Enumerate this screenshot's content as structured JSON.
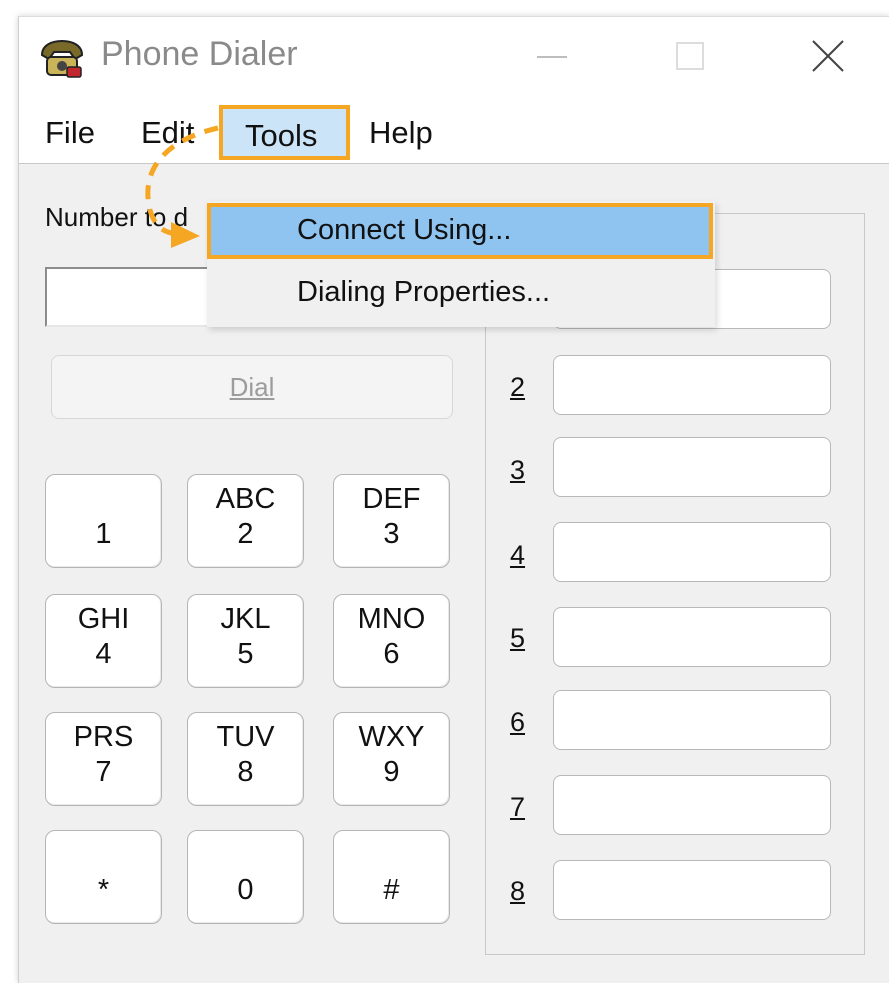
{
  "window": {
    "title": "Phone Dialer"
  },
  "menubar": {
    "items": [
      "File",
      "Edit",
      "Tools",
      "Help"
    ]
  },
  "tools_menu": {
    "items": [
      "Connect Using...",
      "Dialing Properties..."
    ]
  },
  "form": {
    "number_label": "Number to d",
    "dial_label": "Dial"
  },
  "keypad": [
    {
      "letters": "",
      "digit": "1"
    },
    {
      "letters": "ABC",
      "digit": "2"
    },
    {
      "letters": "DEF",
      "digit": "3"
    },
    {
      "letters": "GHI",
      "digit": "4"
    },
    {
      "letters": "JKL",
      "digit": "5"
    },
    {
      "letters": "MNO",
      "digit": "6"
    },
    {
      "letters": "PRS",
      "digit": "7"
    },
    {
      "letters": "TUV",
      "digit": "8"
    },
    {
      "letters": "WXY",
      "digit": "9"
    },
    {
      "letters": "",
      "digit": "*"
    },
    {
      "letters": "",
      "digit": "0"
    },
    {
      "letters": "",
      "digit": "#"
    }
  ],
  "speed_dial": {
    "numbers": [
      "2",
      "3",
      "4",
      "5",
      "6",
      "7",
      "8"
    ]
  },
  "highlight_color": "#f5a623",
  "icons": [
    "phone-app-icon",
    "minimize-icon",
    "maximize-icon",
    "close-icon",
    "curved-arrow-icon"
  ]
}
